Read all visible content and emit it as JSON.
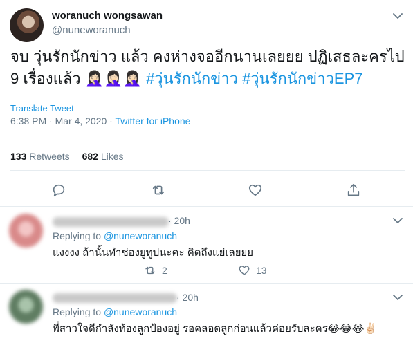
{
  "tweet": {
    "display_name": "woranuch wongsawan",
    "handle": "@nuneworanuch",
    "text_line1": "จบ วุ่นรักนักข่าว แล้ว คงห่างจออีกนานเลยยย ปฏิเสธละครไป",
    "text_line2_plain": "9 เรื่องแล้ว 🤦🏻‍♀️🤦🏻‍♀️🤦🏻‍♀️ ",
    "hashtags": [
      "#วุ่นรักนักข่าว",
      "#วุ่นรักนักข่าวEP7"
    ],
    "translate_label": "Translate Tweet",
    "timestamp": "6:38 PM · Mar 4, 2020",
    "separator": " · ",
    "source": "Twitter for iPhone",
    "retweets_count": "133",
    "retweets_label": "Retweets",
    "likes_count": "682",
    "likes_label": "Likes",
    "actions": [
      "reply-icon",
      "retweet-icon",
      "like-icon",
      "share-icon"
    ]
  },
  "replies": [
    {
      "time": "· 20h",
      "replying_prefix": "Replying to ",
      "mention": "@nuneworanuch",
      "text": "แงงงง ถ้านั้นทำช่องยูทูปนะคะ คิดถึงแย่เลยยย",
      "retweets": "2",
      "likes": "13",
      "avatar_color": "#e8a3a3"
    },
    {
      "time": "· 20h",
      "replying_prefix": "Replying to ",
      "mention": "@nuneworanuch",
      "text": "พี่สาวใจดีกำลังท้องลูกป้องอยู่ รอคลอดลูกก่อนแล้วค่อยรับละคร😂😂😂✌🏻",
      "avatar_color": "#7fa082"
    }
  ],
  "colors": {
    "link": "#1b95e0",
    "secondary": "#657786",
    "text": "#14171a",
    "divider": "#e6ecf0"
  }
}
